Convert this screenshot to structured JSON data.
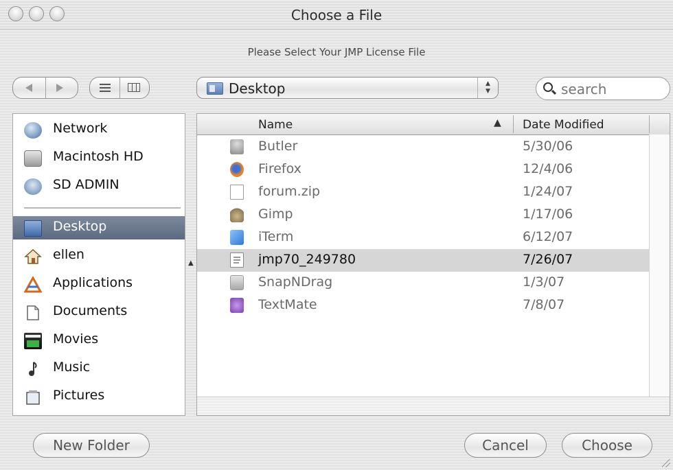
{
  "window": {
    "title": "Choose a File"
  },
  "dialog": {
    "prompt": "Please Select Your JMP License File"
  },
  "toolbar": {
    "location": "Desktop",
    "search": {
      "value": "",
      "placeholder": "search"
    }
  },
  "sidebar": {
    "devices": [
      {
        "label": "Network",
        "icon": "network-icon"
      },
      {
        "label": "Macintosh HD",
        "icon": "hard-disk-icon"
      },
      {
        "label": "SD ADMIN",
        "icon": "disk-icon"
      }
    ],
    "places": [
      {
        "label": "Desktop",
        "icon": "desktop-icon",
        "selected": true
      },
      {
        "label": "ellen",
        "icon": "home-icon"
      },
      {
        "label": "Applications",
        "icon": "applications-icon"
      },
      {
        "label": "Documents",
        "icon": "documents-icon"
      },
      {
        "label": "Movies",
        "icon": "movies-icon"
      },
      {
        "label": "Music",
        "icon": "music-icon"
      },
      {
        "label": "Pictures",
        "icon": "pictures-icon"
      }
    ]
  },
  "filelist": {
    "columns": {
      "name": "Name",
      "date": "Date Modified"
    },
    "files": [
      {
        "name": "Butler",
        "date": "5/30/06",
        "icon": "butler-app-icon"
      },
      {
        "name": "Firefox",
        "date": "12/4/06",
        "icon": "firefox-app-icon"
      },
      {
        "name": "forum.zip",
        "date": "1/24/07",
        "icon": "zip-file-icon"
      },
      {
        "name": "Gimp",
        "date": "1/17/06",
        "icon": "gimp-app-icon"
      },
      {
        "name": "iTerm",
        "date": "6/12/07",
        "icon": "iterm-app-icon"
      },
      {
        "name": "jmp70_249780",
        "date": "7/26/07",
        "icon": "document-icon",
        "selected": true
      },
      {
        "name": "SnapNDrag",
        "date": "1/3/07",
        "icon": "snapndrag-app-icon"
      },
      {
        "name": "TextMate",
        "date": "7/8/07",
        "icon": "textmate-app-icon"
      }
    ]
  },
  "buttons": {
    "new_folder": "New Folder",
    "cancel": "Cancel",
    "choose": "Choose"
  }
}
